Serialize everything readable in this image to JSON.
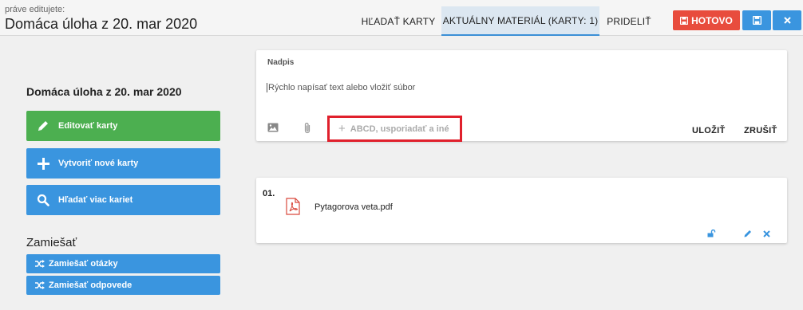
{
  "header": {
    "edit_label": "práve editujete:",
    "title": "Domáca úloha z 20. mar 2020",
    "tabs": [
      {
        "label": "HĽADAŤ KARTY"
      },
      {
        "label": "AKTUÁLNY MATERIÁL (KARTY: 1)",
        "active": true
      },
      {
        "label": "PRIDELIŤ"
      }
    ],
    "done_label": "HOTOVO",
    "save_icon": "save-icon",
    "close_icon": "close-icon"
  },
  "sidebar": {
    "title": "Domáca úloha z 20. mar 2020",
    "buttons": [
      {
        "label": "Editovať karty",
        "icon": "pencil-icon",
        "color": "#4caf50"
      },
      {
        "label": "Vytvoriť nové karty",
        "icon": "plus-icon",
        "color": "#3a95df"
      },
      {
        "label": "Hľadať viac kariet",
        "icon": "search-icon",
        "color": "#3a95df"
      }
    ],
    "shuffle_title": "Zamiešať",
    "shuffle_buttons": [
      {
        "label": "Zamiešať otázky",
        "icon": "shuffle-icon"
      },
      {
        "label": "Zamiešať odpovede",
        "icon": "shuffle-icon"
      }
    ]
  },
  "editor": {
    "heading_label": "Nadpis",
    "placeholder": "Rýchlo napísať text alebo vložiť súbor",
    "options_label": "ABCD, usporiadať a iné",
    "save_label": "ULOŽIŤ",
    "cancel_label": "ZRUŠIŤ"
  },
  "cards": [
    {
      "number": "01.",
      "file_name": "Pytagorova veta.pdf",
      "file_icon": "pdf-icon"
    }
  ],
  "colors": {
    "accent": "#3a95df",
    "danger": "#e84c3d",
    "success": "#4caf50",
    "highlight": "#e0202c"
  }
}
